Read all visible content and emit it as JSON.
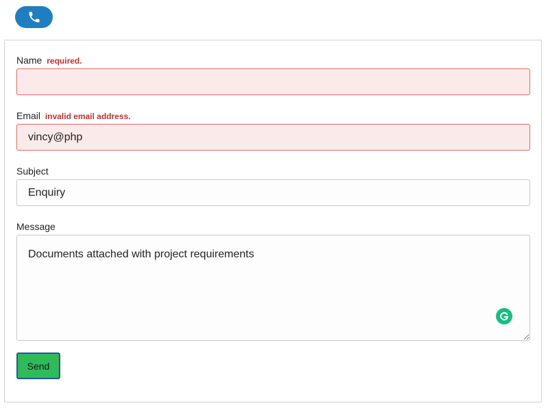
{
  "header": {
    "phone_icon": "phone-icon",
    "accent_color": "#1f7ec1"
  },
  "form": {
    "name": {
      "label": "Name",
      "error": "required.",
      "value": ""
    },
    "email": {
      "label": "Email",
      "error": "invalid email address.",
      "value": "vincy@php"
    },
    "subject": {
      "label": "Subject",
      "value": "Enquiry"
    },
    "message": {
      "label": "Message",
      "value": "Documents attached with project requirements"
    },
    "send_label": "Send",
    "grammarly_icon": "grammarly-icon",
    "colors": {
      "error_text": "#c0322b",
      "error_bg": "#faebea",
      "error_border": "#dd6a61",
      "send_bg": "#2fbb5a",
      "send_border": "#1e5a9c"
    }
  }
}
